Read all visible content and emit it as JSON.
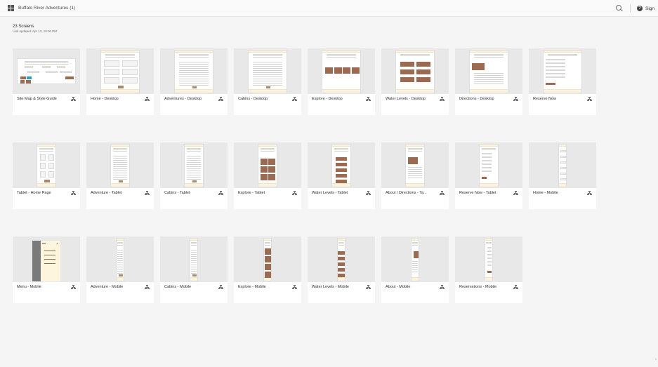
{
  "window": {
    "title": "Buffalo River Adventures (1)"
  },
  "header": {
    "grid_icon": "grid-icon",
    "search_icon": "search-icon",
    "help_icon": "help-icon",
    "help_glyph": "?",
    "sign_in_label": "Sign"
  },
  "summary": {
    "screen_count": "23 Screens",
    "link_updated": "Link updated: Apr 13, 10:00 PM"
  },
  "screens": [
    {
      "label": "Site Map & Style Guide",
      "kind": "sitemap"
    },
    {
      "label": "Home - Desktop",
      "kind": "desktop-home"
    },
    {
      "label": "Adventures - Desktop",
      "kind": "desktop-text"
    },
    {
      "label": "Cabins - Desktop",
      "kind": "desktop-text"
    },
    {
      "label": "Explore - Desktop",
      "kind": "desktop-tiles"
    },
    {
      "label": "Water Levels - Desktop",
      "kind": "desktop-grid"
    },
    {
      "label": "Directions - Desktop",
      "kind": "desktop-map"
    },
    {
      "label": "Reserve Now",
      "kind": "desktop-form"
    },
    {
      "label": "Tablet - Home Page",
      "kind": "tablet-home"
    },
    {
      "label": "Adventure - Tablet",
      "kind": "tablet-text"
    },
    {
      "label": "Cabins - Tablet",
      "kind": "tablet-text"
    },
    {
      "label": "Explore - Tablet",
      "kind": "tablet-tiles"
    },
    {
      "label": "Water Levels - Tablet",
      "kind": "tablet-stack"
    },
    {
      "label": "About / Directions - Ta...",
      "kind": "tablet-map"
    },
    {
      "label": "Reserve Now - Tablet",
      "kind": "tablet-form"
    },
    {
      "label": "Home - Mobile",
      "kind": "mobile-home"
    },
    {
      "label": "Menu - Mobile",
      "kind": "menu"
    },
    {
      "label": "Adventure - Mobile",
      "kind": "mobile-text"
    },
    {
      "label": "Cabins - Mobile",
      "kind": "mobile-text"
    },
    {
      "label": "Explore - Mobile",
      "kind": "mobile-tiles"
    },
    {
      "label": "Water Levels - Mobile",
      "kind": "mobile-stack"
    },
    {
      "label": "About - Mobile",
      "kind": "mobile-map"
    },
    {
      "label": "Reservations - Mobile",
      "kind": "mobile-form"
    }
  ],
  "colors": {
    "accent_brown": "#9b6a50",
    "header_cream": "#fbf3de",
    "thumb_gray": "#e8e8e8"
  }
}
